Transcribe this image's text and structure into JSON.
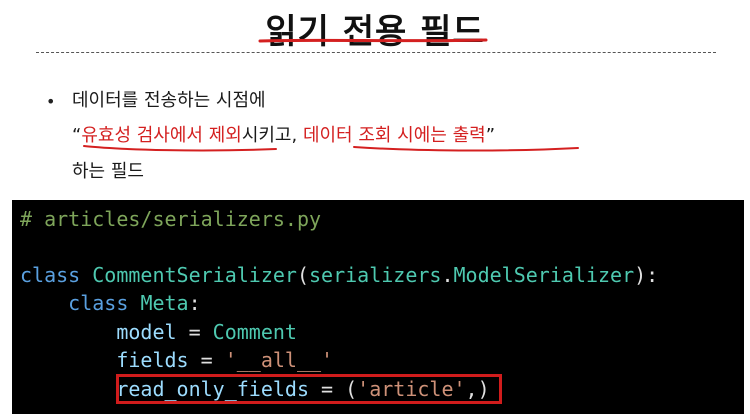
{
  "slide": {
    "title": "읽기 전용 필드",
    "bullet": {
      "marker": "•",
      "line1": "데이터를 전송하는 시점에",
      "line2_open_quote": "“",
      "line2_highlight1": "유효성 검사에서 제외",
      "line2_mid": "시키고, ",
      "line2_highlight2": "데이터 조회 시에는 출력",
      "line2_close_quote": "”",
      "line3": "하는 필드"
    }
  },
  "code": {
    "comment": "# articles/serializers.py",
    "class_kw": "class",
    "class_name": "CommentSerializer",
    "paren_open": "(",
    "base_module": "serializers",
    "dot": ".",
    "base_class": "ModelSerializer",
    "paren_close_colon": "):",
    "meta_kw": "class",
    "meta_name": "Meta",
    "meta_colon": ":",
    "model_name": "model",
    "assign1": " = ",
    "model_value": "Comment",
    "fields_name": "fields",
    "assign2": " = ",
    "fields_value": "'__all__'",
    "ro_name": "read_only_fields",
    "assign3": " = ",
    "ro_open": "(",
    "ro_value": "'article'",
    "ro_close": ",)"
  },
  "colors": {
    "highlight": "#d42020",
    "box_border": "#d01c1c",
    "code_bg": "#000000"
  }
}
